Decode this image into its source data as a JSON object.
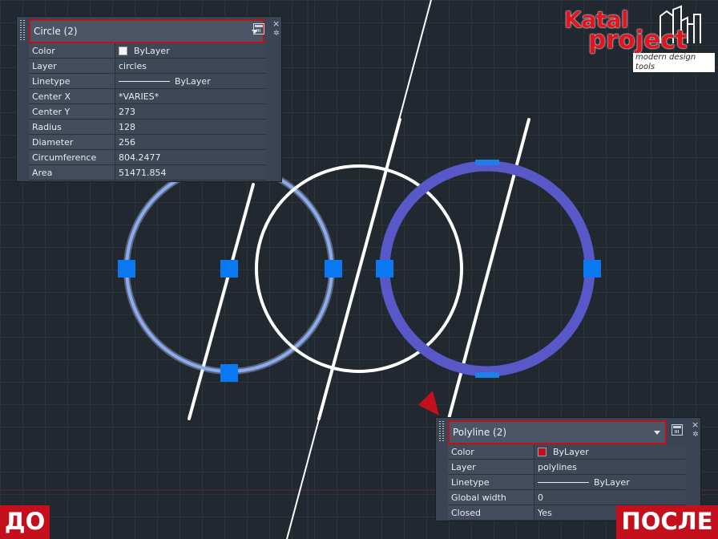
{
  "top_panel": {
    "selector": "Circle (2)",
    "rows": [
      {
        "key": "Color",
        "value": "ByLayer",
        "swatch": "#f4f4f4"
      },
      {
        "key": "Layer",
        "value": "circles"
      },
      {
        "key": "Linetype",
        "value": "ByLayer",
        "line_sample": true
      },
      {
        "key": "Center X",
        "value": "*VARIES*"
      },
      {
        "key": "Center Y",
        "value": "273"
      },
      {
        "key": "Radius",
        "value": "128"
      },
      {
        "key": "Diameter",
        "value": "256"
      },
      {
        "key": "Circumference",
        "value": "804.2477"
      },
      {
        "key": "Area",
        "value": "51471.854"
      }
    ],
    "close": "×",
    "settings": "✲",
    "quickselect_icon": "quickselect-icon"
  },
  "bottom_panel": {
    "selector": "Polyline (2)",
    "rows": [
      {
        "key": "Color",
        "value": "ByLayer",
        "swatch": "#c4101c"
      },
      {
        "key": "Layer",
        "value": "polylines"
      },
      {
        "key": "Linetype",
        "value": "ByLayer",
        "line_sample": true
      },
      {
        "key": "Global width",
        "value": "0"
      },
      {
        "key": "Closed",
        "value": "Yes"
      }
    ],
    "close": "×",
    "settings": "✲",
    "quickselect_icon": "quickselect-icon"
  },
  "labels": {
    "before": "ДО",
    "after": "ПОСЛЕ"
  },
  "logo": {
    "line1": "Katal",
    "line2": "project",
    "tagline": "modern design tools"
  },
  "colors": {
    "canvas_bg": "#212830",
    "grip": "#0a78f0",
    "selected_circle": "#8aaaf2",
    "polyline_circle": "#5858c8",
    "accent_red": "#c4101c"
  }
}
